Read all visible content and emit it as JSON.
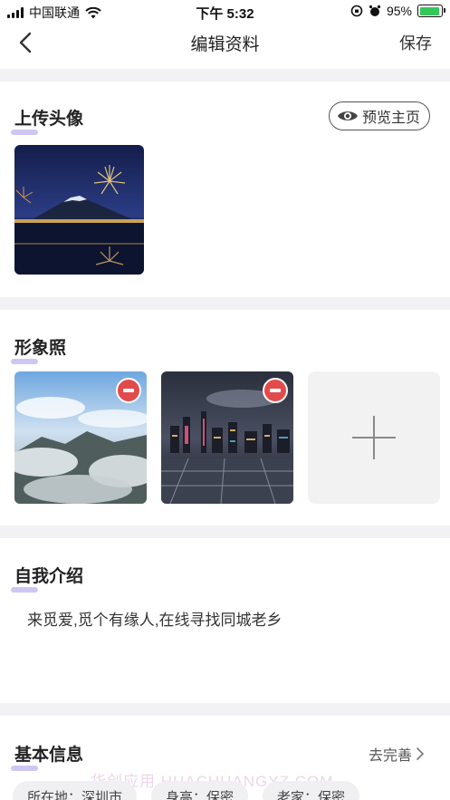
{
  "status_bar": {
    "carrier": "中国联通",
    "time": "下午 5:32",
    "battery": "95%",
    "battery_level": 0.95
  },
  "nav": {
    "title": "编辑资料",
    "save_label": "保存"
  },
  "avatar_section": {
    "title": "上传头像",
    "preview_label": "预览主页"
  },
  "photos_section": {
    "title": "形象照"
  },
  "intro_section": {
    "title": "自我介绍",
    "text": "来觅爱,觅个有缘人,在线寻找同城老乡"
  },
  "basic_info": {
    "title": "基本信息",
    "complete_label": "去完善",
    "chips": [
      "所在地：深圳市",
      "身高：保密",
      "老家：保密"
    ]
  },
  "watermark": "华创应用 HUACHUANGYZ.COM",
  "colors": {
    "accent_underline": "#cfc7f2",
    "remove_badge": "#e24b4b",
    "divider": "#f2f2f4"
  }
}
